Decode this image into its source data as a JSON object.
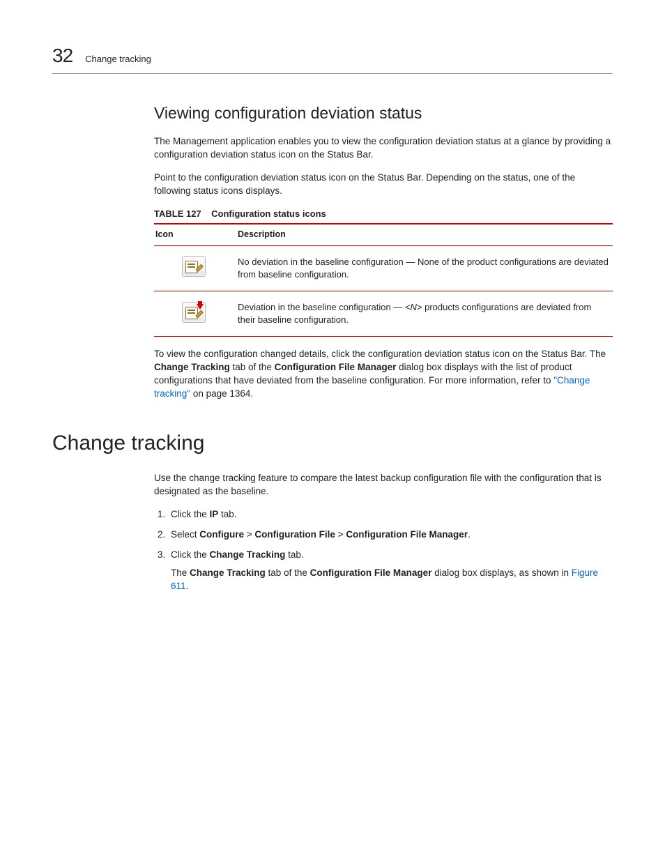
{
  "header": {
    "chapter_number": "32",
    "chapter_title": "Change tracking"
  },
  "section1": {
    "heading": "Viewing configuration deviation status",
    "para1": "The Management application enables you to view the configuration deviation status at a glance by providing a configuration deviation status icon on the Status Bar.",
    "para2": "Point to the configuration deviation status icon on the Status Bar. Depending on the status, one of the following status icons displays.",
    "table_label": "TABLE 127",
    "table_caption": "Configuration status icons",
    "col1": "Icon",
    "col2": "Description",
    "row1_desc": "No deviation in the baseline configuration — None of the product configurations are deviated from baseline configuration.",
    "row2_pre": "Deviation in the baseline configuration — ",
    "row2_n": "<N>",
    "row2_post": " products configurations are deviated from their baseline configuration.",
    "para3_a": "To view the configuration changed details, click the configuration deviation status icon on the Status Bar. The ",
    "para3_b": "Change Tracking",
    "para3_c": " tab of the ",
    "para3_d": "Configuration File Manager",
    "para3_e": " dialog box displays with the list of product configurations that have deviated from the baseline configuration. For more information, refer to ",
    "para3_link": "\"Change tracking\"",
    "para3_f": " on page 1364."
  },
  "section2": {
    "heading": "Change tracking",
    "para1": "Use the change tracking feature to compare the latest backup configuration file with the configuration that is designated as the baseline.",
    "step1_a": "Click the ",
    "step1_b": "IP",
    "step1_c": " tab.",
    "step2_a": "Select ",
    "step2_b": "Configure",
    "step2_c": " > ",
    "step2_d": "Configuration File",
    "step2_e": " > ",
    "step2_f": "Configuration File Manager",
    "step2_g": ".",
    "step3_a": "Click the ",
    "step3_b": "Change Tracking",
    "step3_c": " tab.",
    "step3_follow_a": "The ",
    "step3_follow_b": "Change Tracking",
    "step3_follow_c": " tab of the ",
    "step3_follow_d": "Configuration File Manager",
    "step3_follow_e": " dialog box displays, as shown in ",
    "step3_follow_link": "Figure 611",
    "step3_follow_f": "."
  }
}
